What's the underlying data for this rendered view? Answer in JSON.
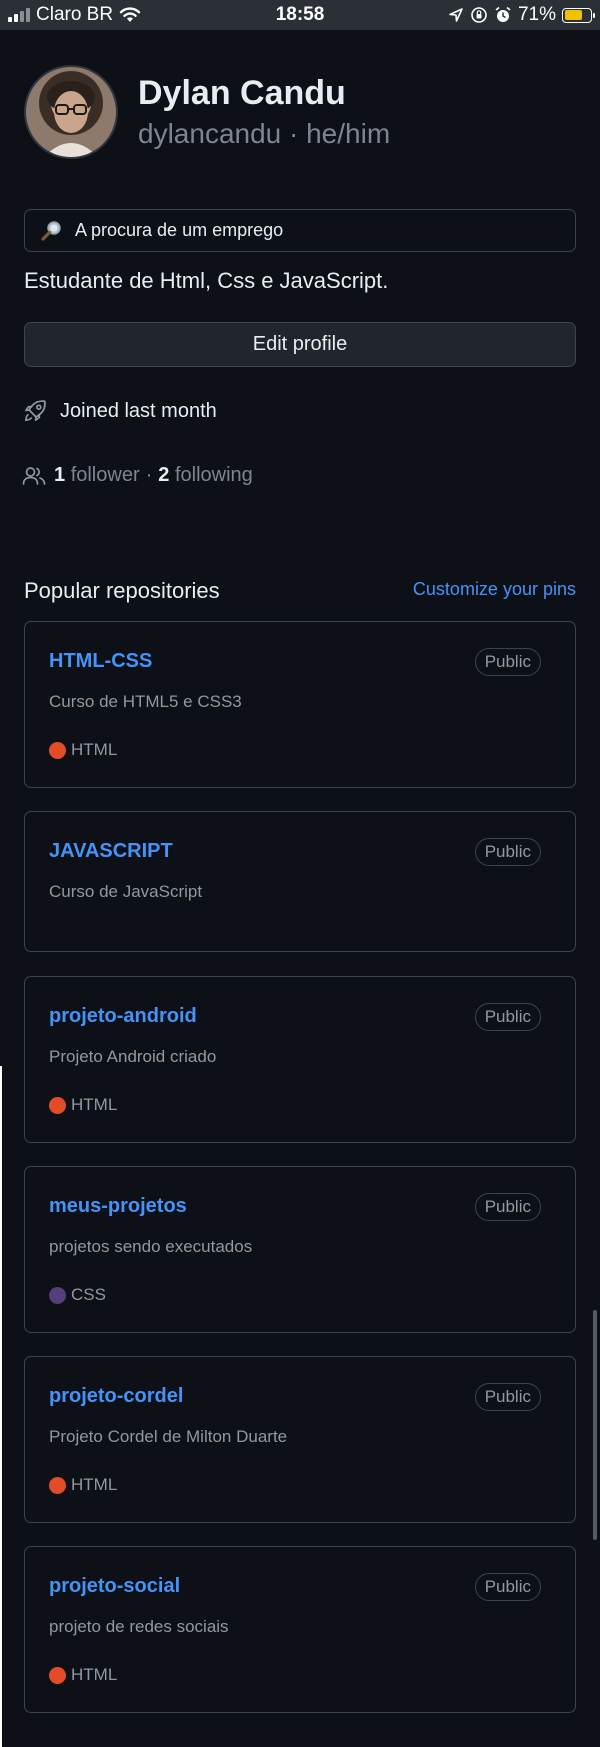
{
  "status_bar": {
    "carrier": "Claro BR",
    "time": "18:58",
    "battery": "71%",
    "battery_fraction": 0.71
  },
  "profile": {
    "name": "Dylan Candu",
    "username_pronouns": "dylancandu · he/him",
    "status_text": "A procura de um emprego",
    "bio": "Estudante de Html, Css e JavaScript.",
    "edit_label": "Edit profile",
    "joined": "Joined last month",
    "followers_count": "1",
    "followers_label": "follower",
    "separator": "·",
    "following_count": "2",
    "following_label": "following"
  },
  "repos_section": {
    "title": "Popular repositories",
    "customize_label": "Customize your pins"
  },
  "repos": [
    {
      "name": "HTML-CSS",
      "visibility": "Public",
      "description": "Curso de HTML5 e CSS3",
      "language": "HTML",
      "lang_color": "#e34c26"
    },
    {
      "name": "JAVASCRIPT",
      "visibility": "Public",
      "description": "Curso de JavaScript",
      "language": "",
      "lang_color": ""
    },
    {
      "name": "projeto-android",
      "visibility": "Public",
      "description": "Projeto Android criado",
      "language": "HTML",
      "lang_color": "#e34c26"
    },
    {
      "name": "meus-projetos",
      "visibility": "Public",
      "description": "projetos sendo executados",
      "language": "CSS",
      "lang_color": "#563d7c"
    },
    {
      "name": "projeto-cordel",
      "visibility": "Public",
      "description": "Projeto Cordel de Milton Duarte",
      "language": "HTML",
      "lang_color": "#e34c26"
    },
    {
      "name": "projeto-social",
      "visibility": "Public",
      "description": "projeto de redes sociais",
      "language": "HTML",
      "lang_color": "#e34c26"
    }
  ],
  "icons": {
    "status": "magnifying-glass-icon",
    "joined": "rocket-icon",
    "followers": "people-icon"
  }
}
